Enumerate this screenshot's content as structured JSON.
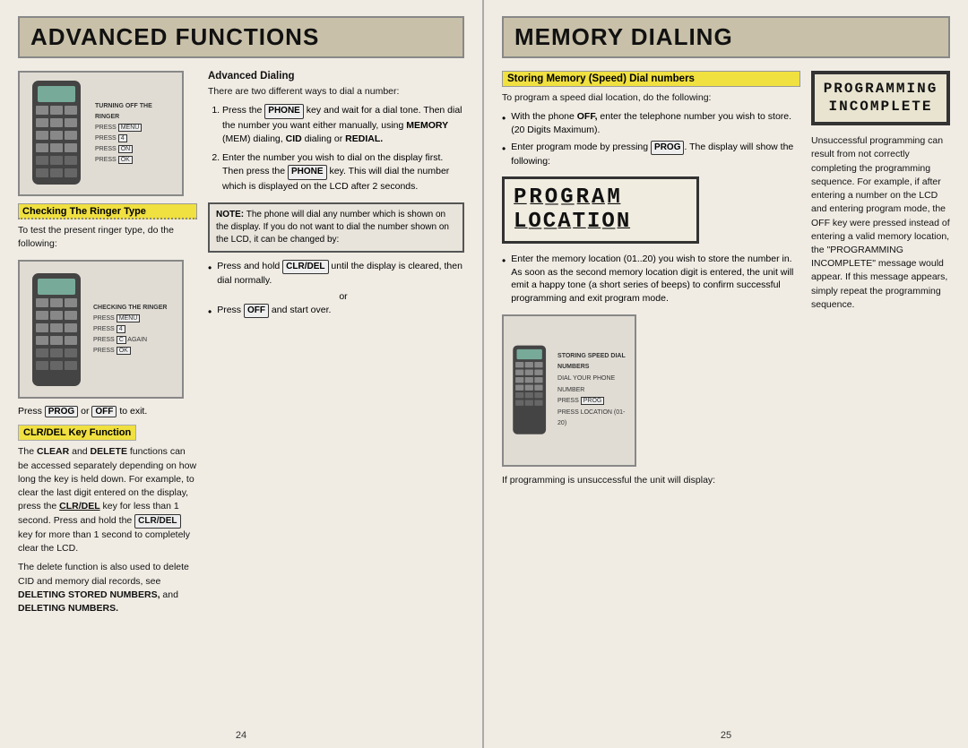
{
  "left_page": {
    "title": "ADVANCED FUNCTIONS",
    "page_number": "24",
    "phone_labels_1": {
      "title": "TURNING OFF THE RINGER",
      "line1": "PRESS",
      "line2": "PRESS",
      "line3": "PRESS",
      "line4": "PRESS"
    },
    "checking_ringer": {
      "heading": "Checking The Ringer Type",
      "body": "To test the present ringer type, do the following:"
    },
    "phone_labels_2": {
      "title": "CHECKING THE RINGER",
      "line1": "PRESS",
      "line2": "PRESS",
      "line3": "PRESS",
      "line4": "AGAIN",
      "line5": "PRESS",
      "line6": "PRESS"
    },
    "press_line": "Press",
    "prog_key": "PROG",
    "or_text": "or",
    "off_key": "OFF",
    "to_exit": "to exit.",
    "clr_del": {
      "heading": "CLR/DEL Key Function",
      "body1": "The CLEAR and DELETE functions can be accessed separately depending on how long the key is held down. For example, to clear the last digit entered on the display, press the CLR/DEL key for less than 1 second. Press and hold the CLR/DEL key for more than 1 second to completely clear the LCD.",
      "body2": "The delete function is also used to delete CID and memory dial records, see DELETING STORED NUMBERS, and DELETING NUMBERS."
    },
    "advanced_dialing": {
      "heading": "Advanced Dialing",
      "intro": "There are two different ways to dial a number:",
      "step1_a": "Press the",
      "step1_phone": "PHONE",
      "step1_b": "key and wait for a dial tone. Then dial the number you want either manually, using",
      "step1_bold1": "MEMORY",
      "step1_b2": "(MEM) dialing,",
      "step1_bold2": "CID",
      "step1_b3": "dialing or",
      "step1_bold3": "REDIAL.",
      "step2_a": "Enter the number you wish to dial on the display first. Then press the",
      "step2_phone": "PHONE",
      "step2_b": "key. This will dial the number which is displayed on the LCD after 2 seconds."
    },
    "note_box": {
      "title": "NOTE:",
      "text": "The phone will dial any number which is shown on the display. If you do not want to dial the number shown on the LCD, it can be changed by:"
    },
    "bullets": {
      "b1_a": "Press and hold",
      "b1_key": "CLR/DEL",
      "b1_b": "until the display is cleared, then dial normally.",
      "b1_or": "or",
      "b2_a": "Press",
      "b2_key": "OFF",
      "b2_b": "and start over."
    }
  },
  "right_page": {
    "title": "MEMORY DIALING",
    "page_number": "25",
    "storing": {
      "heading": "Storing Memory (Speed) Dial numbers",
      "intro": "To program a speed dial location, do the following:",
      "bullet1_a": "With the phone",
      "bullet1_off": "OFF,",
      "bullet1_b": "enter the telephone number you wish to store. (20 Digits Maximum).",
      "bullet2_a": "Enter program mode by pressing",
      "bullet2_prog": "PROG.",
      "bullet2_b": "The display will show the following:",
      "program_display_line1": "PROGRAM",
      "program_display_line2": "LOCATION",
      "bullet3_a": "Enter the memory location (01..20) you wish to store the number in. As soon as the second memory location digit is entered, the unit will emit a happy tone (a short series of beeps) to confirm successful programming and exit program mode."
    },
    "phone_labels_3": {
      "title1": "STORING SPEED DIAL NUMBERS",
      "title2": "DIAL YOUR PHONE NUMBER",
      "line1": "PRESS",
      "title3": "PRESS LOCATION (01-20)"
    },
    "unsuccessful": "If programming is unsuccessful the unit will display:",
    "prog_incomplete": {
      "title_line1": "PROGRAMMING",
      "title_line2": "INCOMPLETE",
      "body": "Unsuccessful programming can result from not correctly completing the programming sequence. For example, if after entering a number on the LCD and entering program mode, the OFF key were pressed instead of entering a valid memory location, the \"PROGRAMMING INCOMPLETE\" message would appear. If this message appears, simply repeat the programming sequence."
    }
  }
}
